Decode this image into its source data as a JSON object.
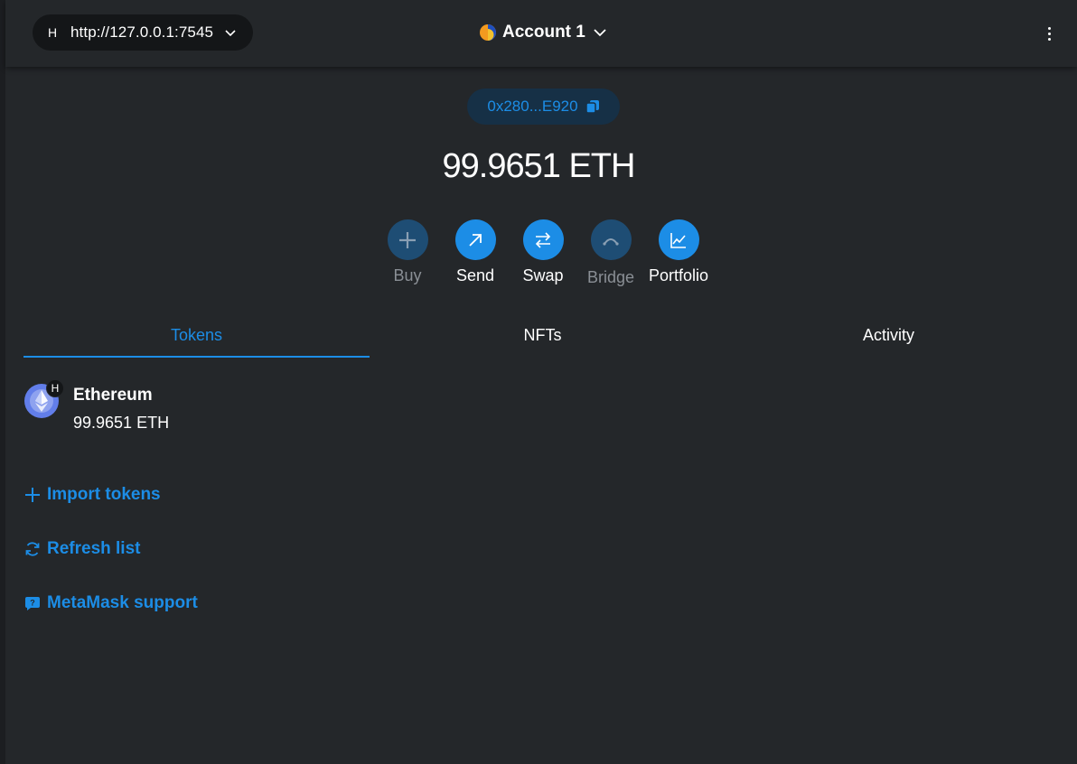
{
  "header": {
    "network_badge": "H",
    "network_url": "http://127.0.0.1:7545",
    "account_name": "Account 1"
  },
  "wallet": {
    "address": "0x280...E920",
    "balance": "99.9651 ETH"
  },
  "actions": [
    {
      "label": "Buy",
      "icon": "plus-icon",
      "enabled": false
    },
    {
      "label": "Send",
      "icon": "arrow-up-right-icon",
      "enabled": true
    },
    {
      "label": "Swap",
      "icon": "swap-arrows-icon",
      "enabled": true
    },
    {
      "label": "Bridge",
      "icon": "bridge-icon",
      "enabled": false
    },
    {
      "label": "Portfolio",
      "icon": "chart-icon",
      "enabled": true
    }
  ],
  "tabs": [
    {
      "label": "Tokens",
      "active": true
    },
    {
      "label": "NFTs",
      "active": false
    },
    {
      "label": "Activity",
      "active": false
    }
  ],
  "tokens": [
    {
      "name": "Ethereum",
      "balance": "99.9651 ETH",
      "badge": "H",
      "icon": "ethereum-icon"
    }
  ],
  "links": {
    "import_tokens": "Import tokens",
    "refresh_list": "Refresh list",
    "support": "MetaMask support"
  },
  "colors": {
    "background": "#24272a",
    "accent": "#1c8de6",
    "disabled": "#1e4d74",
    "address_pill": "#163046"
  }
}
